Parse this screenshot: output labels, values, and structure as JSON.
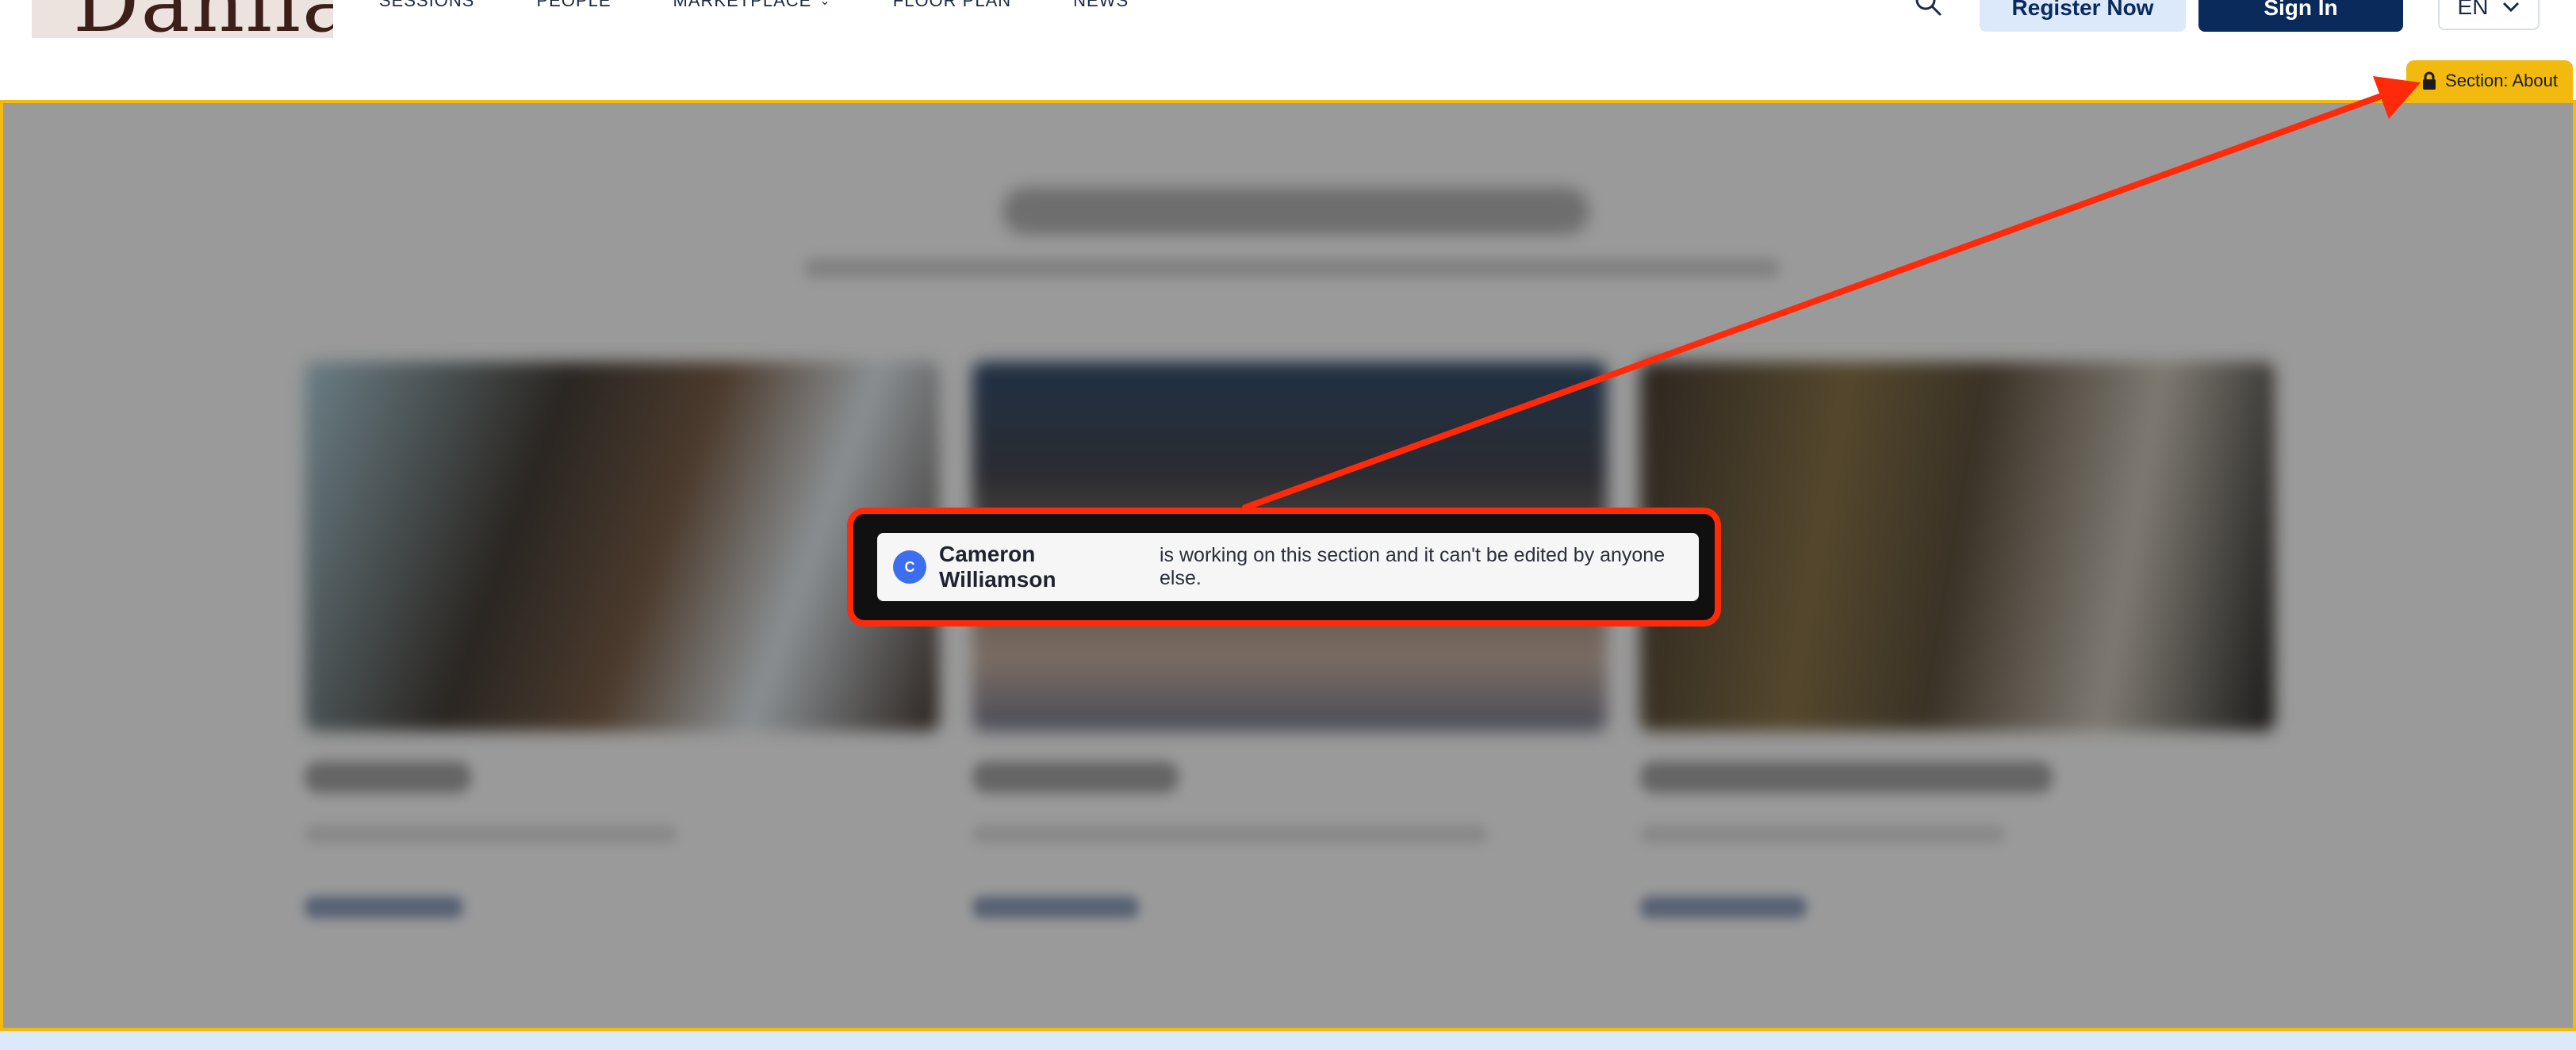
{
  "header": {
    "logo_text": "Dahlia",
    "nav": [
      "SESSIONS",
      "PEOPLE",
      "MARKETPLACE",
      "FLOOR PLAN",
      "NEWS"
    ],
    "register_label": "Register Now",
    "signin_label": "Sign In",
    "language": "EN"
  },
  "section": {
    "badge_label": "Section: About",
    "lock_notice": {
      "avatar_initial": "C",
      "user_name": "Cameron Williamson",
      "message": "is working on this section and it can't be edited by anyone else."
    }
  },
  "colors": {
    "accent": "#f2b90f",
    "annotation": "#ff2a0a",
    "primary": "#0b2a5c"
  },
  "icons": [
    "search-icon",
    "chevron-down-icon",
    "lock-icon"
  ]
}
